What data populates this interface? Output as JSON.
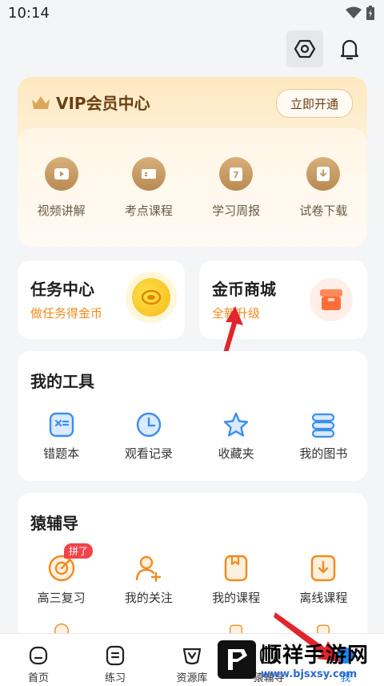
{
  "status": {
    "time": "10:14"
  },
  "vip": {
    "title": "VIP会员中心",
    "open_button": "立即开通",
    "items": [
      {
        "label": "视频讲解",
        "icon": "play-icon"
      },
      {
        "label": "考点课程",
        "icon": "course-icon"
      },
      {
        "label": "学习周报",
        "icon": "calendar-7-icon"
      },
      {
        "label": "试卷下载",
        "icon": "download-icon"
      }
    ]
  },
  "task": {
    "title": "任务中心",
    "subtitle": "做任务得金币"
  },
  "shop": {
    "title": "金币商城",
    "subtitle": "全新升级"
  },
  "tools": {
    "title": "我的工具",
    "items": [
      {
        "label": "错题本",
        "icon": "mistake-book-icon"
      },
      {
        "label": "观看记录",
        "icon": "clock-icon"
      },
      {
        "label": "收藏夹",
        "icon": "star-icon"
      },
      {
        "label": "我的图书",
        "icon": "books-icon"
      }
    ]
  },
  "fudao": {
    "title": "猿辅导",
    "badge": "拼了",
    "items": [
      {
        "label": "高三复习",
        "icon": "target-icon"
      },
      {
        "label": "我的关注",
        "icon": "follow-user-icon"
      },
      {
        "label": "我的课程",
        "icon": "my-course-icon"
      },
      {
        "label": "离线课程",
        "icon": "offline-download-icon"
      }
    ]
  },
  "nav": [
    {
      "label": "首页",
      "icon": "home-icon"
    },
    {
      "label": "练习",
      "icon": "practice-icon"
    },
    {
      "label": "资源库",
      "icon": "resource-icon"
    },
    {
      "label": "猿辅导",
      "icon": "fudao-icon"
    },
    {
      "label": "我",
      "icon": "me-icon"
    }
  ],
  "watermark": {
    "title": "顺祥手游网",
    "url": "www.bjsxsy.com"
  },
  "colors": {
    "accent_orange": "#f28a1c",
    "vip_brown": "#6b3f12",
    "nav_active": "#1d87f0",
    "tool_blue": "#3a8ff0"
  }
}
